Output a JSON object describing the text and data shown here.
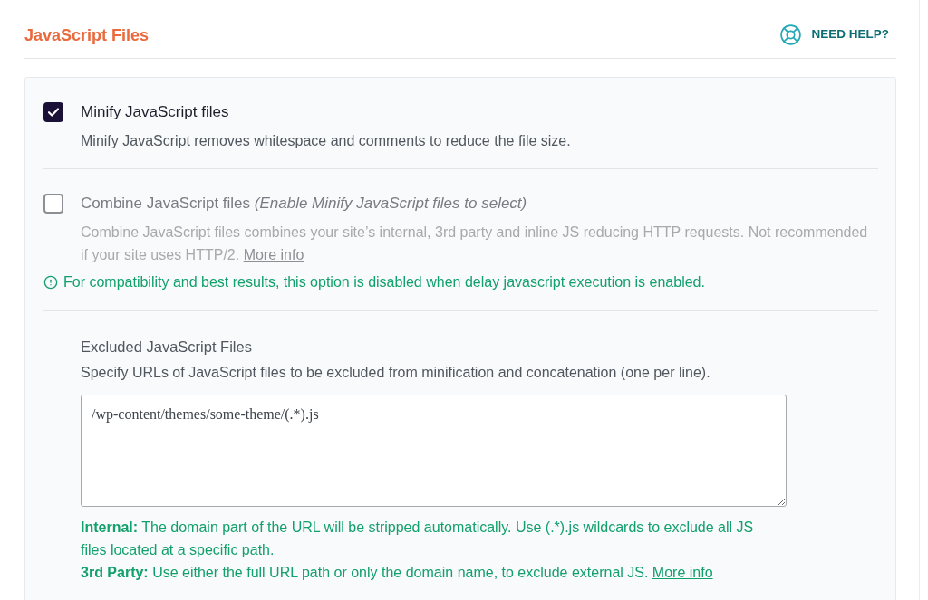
{
  "header": {
    "title": "JavaScript Files",
    "help_link": "NEED HELP?"
  },
  "options": [
    {
      "label": "Minify JavaScript files",
      "checked": true,
      "disabled": false,
      "description": "Minify JavaScript removes whitespace and comments to reduce the file size."
    },
    {
      "label": "Combine JavaScript files",
      "label_note": "(Enable Minify JavaScript files to select)",
      "checked": false,
      "disabled": true,
      "description": "Combine JavaScript files combines your site’s internal, 3rd party and inline JS reducing HTTP requests. Not recommended if your site uses HTTP/2.",
      "description_link": "More info",
      "warning": "For compatibility and best results, this option is disabled when delay javascript execution is enabled."
    }
  ],
  "excluded_files": {
    "title": "Excluded JavaScript Files",
    "description": "Specify URLs of JavaScript files to be excluded from minification and concatenation (one per line).",
    "value": "/wp-content/themes/some-theme/(.*).js",
    "notes": [
      {
        "term": "Internal:",
        "text": "The domain part of the URL will be stripped automatically. Use (.*).js wildcards to exclude all JS files located at a specific path."
      },
      {
        "term": "3rd Party:",
        "text": "Use either the full URL path or only the domain name, to exclude external JS.",
        "link": "More info"
      }
    ]
  }
}
